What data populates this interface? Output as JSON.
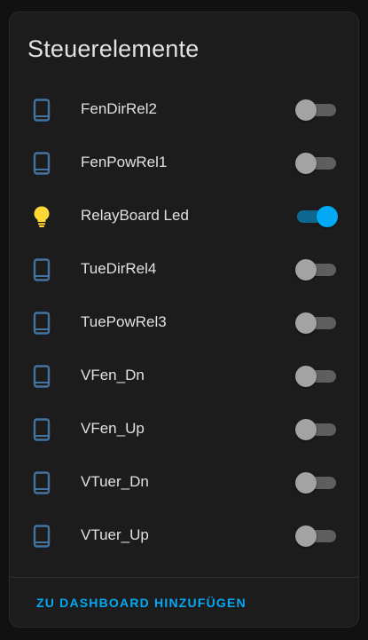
{
  "card": {
    "title": "Steuerelemente",
    "action_label": "ZU DASHBOARD HINZUFÜGEN"
  },
  "colors": {
    "accent": "#03a9f4",
    "icon_blue": "#44739e",
    "icon_yellow": "#fdd835"
  },
  "entities": [
    {
      "label": "FenDirRel2",
      "icon": "cellphone-icon",
      "state": "off"
    },
    {
      "label": "FenPowRel1",
      "icon": "cellphone-icon",
      "state": "off"
    },
    {
      "label": "RelayBoard Led",
      "icon": "lightbulb-icon",
      "state": "on"
    },
    {
      "label": "TueDirRel4",
      "icon": "cellphone-icon",
      "state": "off"
    },
    {
      "label": "TuePowRel3",
      "icon": "cellphone-icon",
      "state": "off"
    },
    {
      "label": "VFen_Dn",
      "icon": "cellphone-icon",
      "state": "off"
    },
    {
      "label": "VFen_Up",
      "icon": "cellphone-icon",
      "state": "off"
    },
    {
      "label": "VTuer_Dn",
      "icon": "cellphone-icon",
      "state": "off"
    },
    {
      "label": "VTuer_Up",
      "icon": "cellphone-icon",
      "state": "off"
    }
  ]
}
